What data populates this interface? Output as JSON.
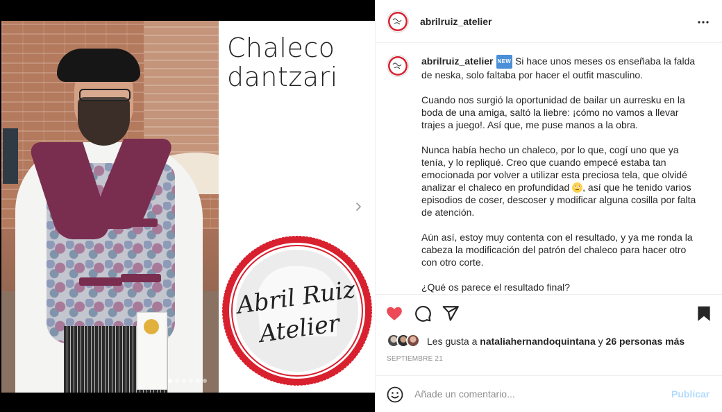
{
  "post": {
    "image_title_line1": "Chaleco",
    "image_title_line2": "dantzari",
    "logo_text_line1": "Abril Ruiz",
    "logo_text_line2": "Atelier",
    "carousel_total": 6,
    "carousel_active": 1
  },
  "header": {
    "username": "abrilruiz_atelier"
  },
  "caption": {
    "username": "abrilruiz_atelier",
    "new_badge": "NEW",
    "p1": "Si hace unos meses os enseñaba la falda de neska, solo faltaba por hacer el outfit masculino.",
    "p2": "Cuando nos surgió la oportunidad de bailar un aurresku en la boda de una amiga, saltó la liebre: ¡cómo no vamos a llevar trajes a juego!. Así que, me puse manos a la obra.",
    "p3a": "Nunca había hecho un chaleco, por lo que, cogí uno que ya tenía, y lo repliqué. Creo que cuando empecé estaba tan emocionada por volver a utilizar esta preciosa tela, que olvidé analizar el chaleco en profundidad",
    "p3b": ", así que he tenido varios episodios de coser, descoser y modificar alguna cosilla por falta de atención.",
    "p4": "Aún así, estoy muy contenta con el resultado, y ya me ronda la cabeza la modificación del patrón del chaleco para hacer otro con otro corte.",
    "p5": "¿Qué os parece el resultado final?"
  },
  "likes": {
    "prefix": "Les gusta a",
    "liker": "nataliahernandoquintana",
    "joiner": "y",
    "others": "26 personas más"
  },
  "date": "SEPTIEMBRE 21",
  "comment": {
    "placeholder": "Añade un comentario...",
    "publish_label": "Publicar"
  },
  "colors": {
    "heart": "#ed4956",
    "publish_disabled": "#b3dbff",
    "logo_red": "#d8202f",
    "new_badge_bg": "#4a8fd8"
  },
  "icons": [
    "more-icon",
    "next-arrow-icon",
    "heart-icon",
    "comment-icon",
    "share-icon",
    "bookmark-icon",
    "emoji-icon"
  ]
}
